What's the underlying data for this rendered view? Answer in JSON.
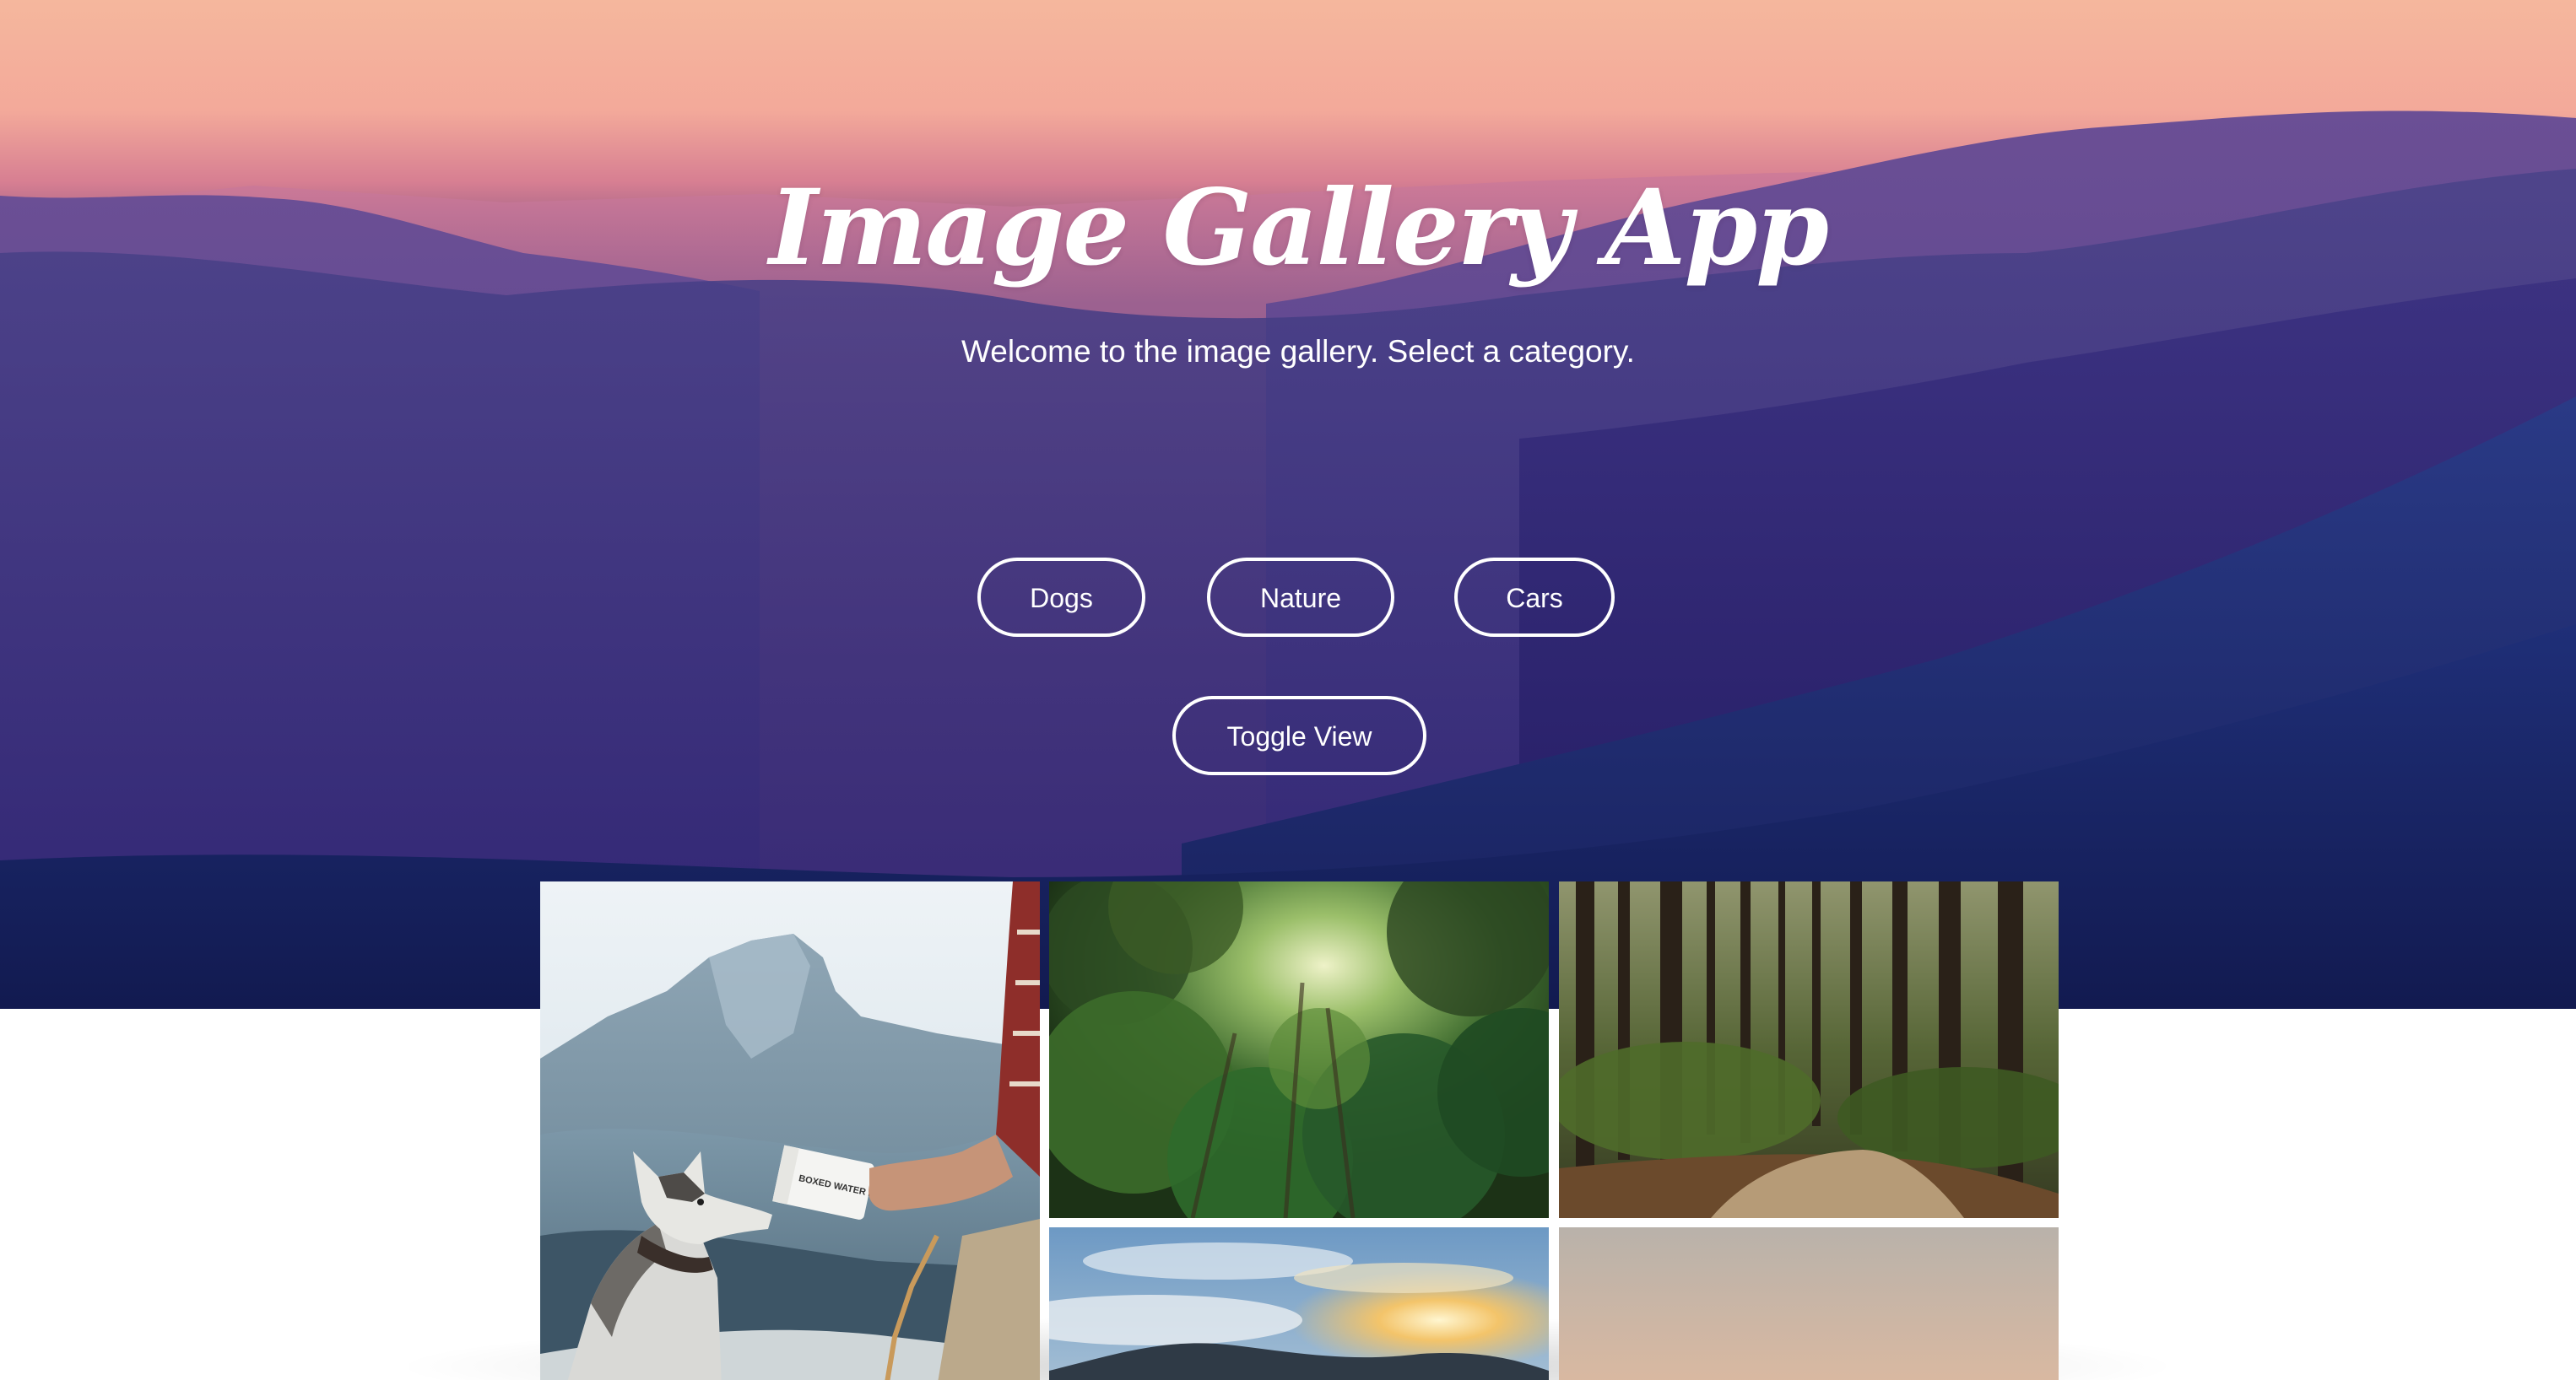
{
  "header": {
    "title": "Image Gallery App",
    "subtitle": "Welcome to the image gallery. Select a category."
  },
  "categories": [
    {
      "label": "Dogs"
    },
    {
      "label": "Nature"
    },
    {
      "label": "Cars"
    }
  ],
  "toggle_view_label": "Toggle View",
  "box_text": "BOXED WATER IS BETTER",
  "gallery": {
    "images": [
      {
        "description": "husky drinking from boxed water carton on mountain cliff"
      },
      {
        "description": "sunlit green forest canopy"
      },
      {
        "description": "tall trees along forest trail"
      },
      {
        "description": "sunset over clouds and mountains"
      },
      {
        "description": "hazy dusk sky"
      }
    ]
  },
  "colors": {
    "button_border": "#ffffff",
    "button_text": "#ffffff",
    "page_background": "#ffffff"
  }
}
